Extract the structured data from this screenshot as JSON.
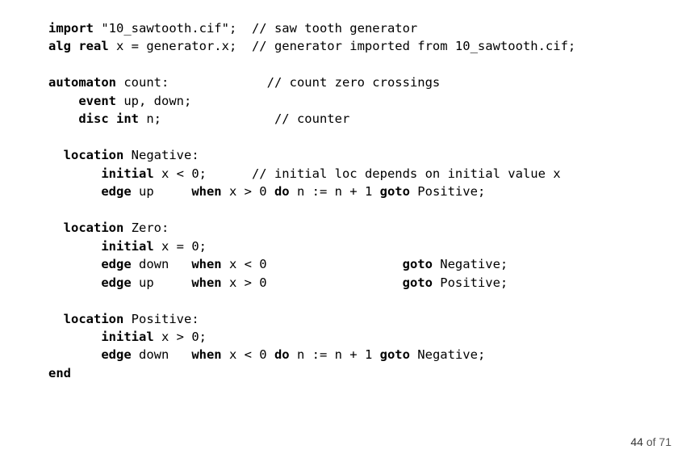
{
  "code": {
    "l1_kw1": "import",
    "l1_t1": " \"10_sawtooth.cif\";  // saw tooth generator",
    "l2_kw1": "alg real",
    "l2_t1": " x = generator.x;  // generator imported from 10_sawtooth.cif;",
    "l4_kw1": "automaton",
    "l4_t1": " count:             // count zero crossings",
    "l5_t0": "    ",
    "l5_kw1": "event",
    "l5_t1": " up, down;",
    "l6_t0": "    ",
    "l6_kw1": "disc int",
    "l6_t1": " n;               // counter",
    "l8_t0": "  ",
    "l8_kw1": "location",
    "l8_t1": " Negative:",
    "l9_t0": "       ",
    "l9_kw1": "initial",
    "l9_t1": " x < 0;      // initial loc depends on initial value x",
    "l10_t0": "       ",
    "l10_kw1": "edge",
    "l10_t1": " up     ",
    "l10_kw2": "when",
    "l10_t2": " x > 0 ",
    "l10_kw3": "do",
    "l10_t3": " n := n + 1 ",
    "l10_kw4": "goto",
    "l10_t4": " Positive;",
    "l12_t0": "  ",
    "l12_kw1": "location",
    "l12_t1": " Zero:",
    "l13_t0": "       ",
    "l13_kw1": "initial",
    "l13_t1": " x = 0;",
    "l14_t0": "       ",
    "l14_kw1": "edge",
    "l14_t1": " down   ",
    "l14_kw2": "when",
    "l14_t2": " x < 0                  ",
    "l14_kw3": "goto",
    "l14_t3": " Negative;",
    "l15_t0": "       ",
    "l15_kw1": "edge",
    "l15_t1": " up     ",
    "l15_kw2": "when",
    "l15_t2": " x > 0                  ",
    "l15_kw3": "goto",
    "l15_t3": " Positive;",
    "l17_t0": "  ",
    "l17_kw1": "location",
    "l17_t1": " Positive:",
    "l18_t0": "       ",
    "l18_kw1": "initial",
    "l18_t1": " x > 0;",
    "l19_t0": "       ",
    "l19_kw1": "edge",
    "l19_t1": " down   ",
    "l19_kw2": "when",
    "l19_t2": " x < 0 ",
    "l19_kw3": "do",
    "l19_t3": " n := n + 1 ",
    "l19_kw4": "goto",
    "l19_t4": " Negative;",
    "l20_kw1": "end"
  },
  "page": {
    "current": "44",
    "of": " of ",
    "total": "71"
  }
}
